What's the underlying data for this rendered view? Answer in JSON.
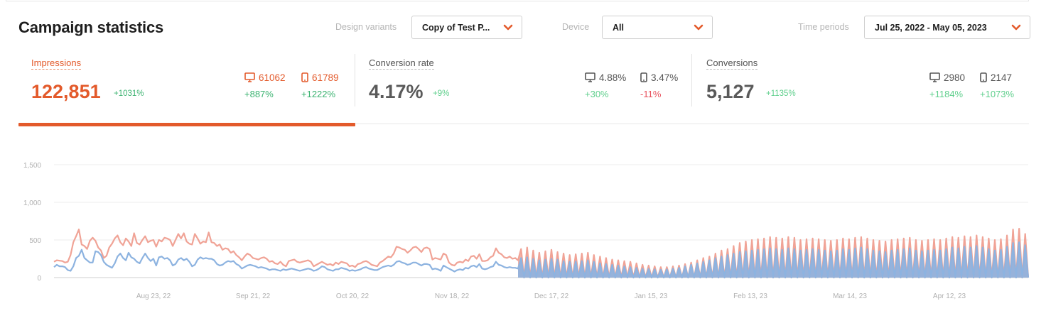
{
  "header": {
    "title": "Campaign statistics",
    "filters": [
      {
        "label": "Design variants",
        "value": "Copy of Test P..."
      },
      {
        "label": "Device",
        "value": "All"
      },
      {
        "label": "Time periods",
        "value": "Jul 25, 2022 - May 05, 2023"
      }
    ]
  },
  "metrics": [
    {
      "label": "Impressions",
      "value": "122,851",
      "delta": "+1031%",
      "desktop": {
        "value": "61062",
        "change": "+887%"
      },
      "mobile": {
        "value": "61789",
        "change": "+1222%"
      }
    },
    {
      "label": "Conversion rate",
      "value": "4.17%",
      "delta": "+9%",
      "desktop": {
        "value": "4.88%",
        "change": "+30%"
      },
      "mobile": {
        "value": "3.47%",
        "change": "-11%"
      }
    },
    {
      "label": "Conversions",
      "value": "5,127",
      "delta": "+1135%",
      "desktop": {
        "value": "2980",
        "change": "+1184%"
      },
      "mobile": {
        "value": "2147",
        "change": "+1073%"
      }
    }
  ],
  "colors": {
    "accent": "#e35a2b",
    "series_total": "#f0a396",
    "series_desktop": "#8db3e0",
    "positive": "#3cb371",
    "negative": "#e8515d"
  },
  "chart_data": {
    "type": "area",
    "start_date": "Jul 25, 2022",
    "end_date": "May 05, 2023",
    "ylim": [
      0,
      1500
    ],
    "yticks": [
      0,
      500,
      1000,
      1500
    ],
    "ytick_labels": [
      "0",
      "500",
      "1,000",
      "1,500"
    ],
    "xtick_labels": [
      "Aug 23, 22",
      "Sep 21, 22",
      "Oct 20, 22",
      "Nov 18, 22",
      "Dec 17, 22",
      "Jan 15, 23",
      "Feb 13, 23",
      "Mar 14, 23",
      "Apr 12, 23"
    ],
    "grid": true,
    "series": [
      {
        "name": "Impressions",
        "values": [
          210,
          230,
          225,
          220,
          200,
          210,
          300,
          470,
          550,
          640,
          440,
          420,
          380,
          490,
          530,
          490,
          400,
          360,
          260,
          290,
          400,
          450,
          520,
          560,
          470,
          430,
          520,
          480,
          420,
          590,
          460,
          440,
          500,
          550,
          470,
          490,
          500,
          410,
          500,
          480,
          530,
          520,
          500,
          420,
          500,
          580,
          520,
          590,
          480,
          450,
          440,
          580,
          520,
          450,
          480,
          470,
          600,
          470,
          460,
          420,
          440,
          370,
          390,
          380,
          330,
          350,
          300,
          270,
          230,
          280,
          320,
          300,
          260,
          250,
          240,
          260,
          270,
          250,
          210,
          220,
          190,
          180,
          210,
          170,
          150,
          220,
          230,
          240,
          210,
          200,
          210,
          220,
          230,
          210,
          150,
          170,
          190,
          210,
          190,
          170,
          180,
          160,
          200,
          180,
          210,
          200,
          190,
          150,
          160,
          140,
          180,
          190,
          210,
          220,
          200,
          170,
          160,
          150,
          200,
          220,
          250,
          280,
          270,
          320,
          410,
          400,
          380,
          370,
          330,
          360,
          400,
          410,
          380,
          340,
          390,
          400,
          380,
          240,
          260,
          250,
          240,
          320,
          300,
          200,
          170,
          160,
          200,
          210,
          200,
          240,
          220,
          280,
          290,
          250,
          310,
          220,
          220,
          230,
          270,
          290,
          390,
          330,
          310,
          270,
          260,
          280,
          250,
          260,
          230
        ]
      },
      {
        "name": "Desktop",
        "values": [
          140,
          170,
          150,
          150,
          140,
          100,
          90,
          150,
          260,
          290,
          370,
          260,
          230,
          200,
          200,
          350,
          340,
          300,
          210,
          170,
          150,
          130,
          190,
          280,
          320,
          260,
          230,
          330,
          270,
          250,
          210,
          190,
          260,
          320,
          260,
          220,
          250,
          160,
          270,
          280,
          250,
          260,
          230,
          160,
          180,
          240,
          260,
          230,
          250,
          210,
          150,
          170,
          240,
          270,
          250,
          260,
          250,
          250,
          230,
          180,
          160,
          170,
          200,
          220,
          210,
          220,
          180,
          160,
          120,
          140,
          160,
          170,
          160,
          150,
          130,
          140,
          130,
          120,
          100,
          110,
          110,
          100,
          90,
          110,
          100,
          110,
          120,
          110,
          100,
          90,
          100,
          110,
          120,
          110,
          90,
          100,
          120,
          150,
          140,
          110,
          100,
          90,
          110,
          110,
          130,
          120,
          110,
          90,
          100,
          90,
          100,
          110,
          130,
          140,
          120,
          110,
          100,
          100,
          120,
          140,
          150,
          160,
          150,
          170,
          210,
          220,
          200,
          190,
          170,
          180,
          200,
          200,
          180,
          160,
          180,
          180,
          170,
          110,
          120,
          110,
          90,
          160,
          140,
          120,
          100,
          80,
          100,
          110,
          100,
          130,
          120,
          150,
          160,
          140,
          180,
          120,
          110,
          120,
          140,
          150,
          210,
          170,
          160,
          140,
          130,
          140,
          130,
          130,
          120
        ]
      }
    ],
    "oscillating_segment": {
      "start_date": "Dec 12, 2022",
      "pattern": "alternating daily peaks and troughs",
      "impressions_peaks": [
        380,
        400,
        360,
        330,
        350,
        370,
        340,
        320,
        300,
        310,
        320,
        330,
        300,
        280,
        260,
        240,
        230,
        220,
        210,
        190,
        170,
        160,
        150,
        140,
        140,
        150,
        160,
        180,
        200,
        230,
        260,
        280,
        320,
        360,
        380,
        420,
        460,
        480,
        500,
        510,
        520,
        540,
        530,
        520,
        540,
        530,
        500,
        510,
        520,
        510,
        500,
        490,
        500,
        520,
        510,
        530,
        540,
        520,
        500,
        490,
        480,
        500,
        510,
        520,
        530,
        500,
        490,
        500,
        510,
        500,
        520,
        540,
        530,
        550,
        540,
        560,
        540,
        520,
        500,
        510,
        560,
        640,
        650,
        580
      ],
      "desktop_peaks": [
        260,
        270,
        250,
        230,
        240,
        250,
        240,
        220,
        210,
        215,
        220,
        230,
        210,
        190,
        180,
        170,
        160,
        150,
        140,
        130,
        120,
        115,
        110,
        105,
        110,
        120,
        130,
        150,
        170,
        190,
        210,
        230,
        260,
        280,
        300,
        320,
        340,
        350,
        360,
        370,
        380,
        390,
        380,
        370,
        390,
        380,
        360,
        370,
        380,
        370,
        360,
        350,
        360,
        380,
        370,
        390,
        400,
        380,
        360,
        350,
        340,
        360,
        370,
        380,
        390,
        360,
        350,
        360,
        370,
        360,
        380,
        400,
        390,
        410,
        400,
        420,
        400,
        380,
        360,
        370,
        410,
        460,
        470,
        430
      ]
    }
  }
}
